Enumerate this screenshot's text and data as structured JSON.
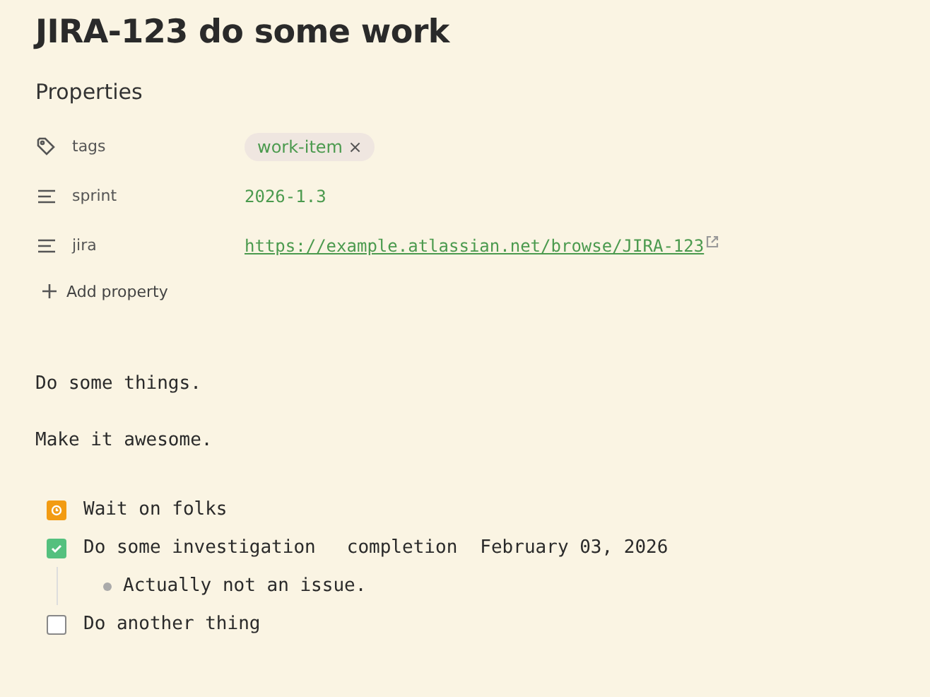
{
  "title": "JIRA-123 do some work",
  "properties": {
    "heading": "Properties",
    "items": [
      {
        "kind": "tags",
        "label": "tags",
        "tags": [
          "work-item"
        ],
        "remove": "×"
      },
      {
        "kind": "text",
        "label": "sprint",
        "value": "2026-1.3"
      },
      {
        "kind": "link",
        "label": "jira",
        "value": "https://example.atlassian.net/browse/JIRA-123"
      }
    ],
    "add": "Add property"
  },
  "paragraphs": [
    "Do some things.",
    "Make it awesome."
  ],
  "tasks": [
    {
      "kind": "waiting",
      "text": "Wait on folks"
    },
    {
      "kind": "task",
      "checked": true,
      "text": "Do some investigation",
      "meta_label": "completion",
      "meta_value": "February 03, 2026",
      "children": [
        "Actually not an issue."
      ]
    },
    {
      "kind": "task",
      "checked": false,
      "text": "Do another thing"
    }
  ]
}
